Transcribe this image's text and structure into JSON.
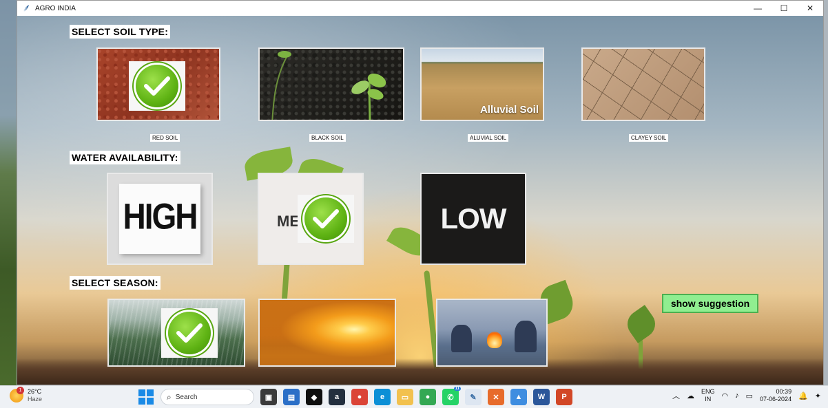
{
  "window": {
    "title": "AGRO INDIA",
    "controls": {
      "minimize": "—",
      "maximize": "☐",
      "close": "✕"
    }
  },
  "sections": {
    "soil": {
      "heading": "SELECT SOIL TYPE:",
      "options": [
        {
          "label": "RED SOIL",
          "selected": true
        },
        {
          "label": "BLACK SOIL",
          "selected": false
        },
        {
          "label": "ALUVIAL SOIL",
          "image_caption": "Alluvial Soil",
          "selected": false
        },
        {
          "label": "CLAYEY SOIL",
          "selected": false
        }
      ]
    },
    "water": {
      "heading": "WATER AVAILABILITY:",
      "options": [
        {
          "image_text": "HIGH",
          "selected": false
        },
        {
          "image_text": "ME",
          "selected": true
        },
        {
          "image_text": "LOW",
          "selected": false
        }
      ]
    },
    "season": {
      "heading": "SELECT SEASON:",
      "options": [
        {
          "name": "monsoon-scene",
          "selected": true
        },
        {
          "name": "summer-scene",
          "selected": false
        },
        {
          "name": "winter-scene",
          "selected": false
        }
      ]
    }
  },
  "actions": {
    "suggest_label": "show suggestion"
  },
  "taskbar": {
    "weather": {
      "temp": "26°C",
      "condition": "Haze",
      "notifications": "1"
    },
    "search_placeholder": "Search",
    "whatsapp_badge": "11",
    "tray": {
      "lang_top": "ENG",
      "lang_bottom": "IN",
      "time": "00:39",
      "date": "07-06-2024"
    }
  },
  "colors": {
    "accent_button": "#90ee90",
    "check_green": "#5fb314",
    "windows_blue": "#1a8ae6"
  }
}
